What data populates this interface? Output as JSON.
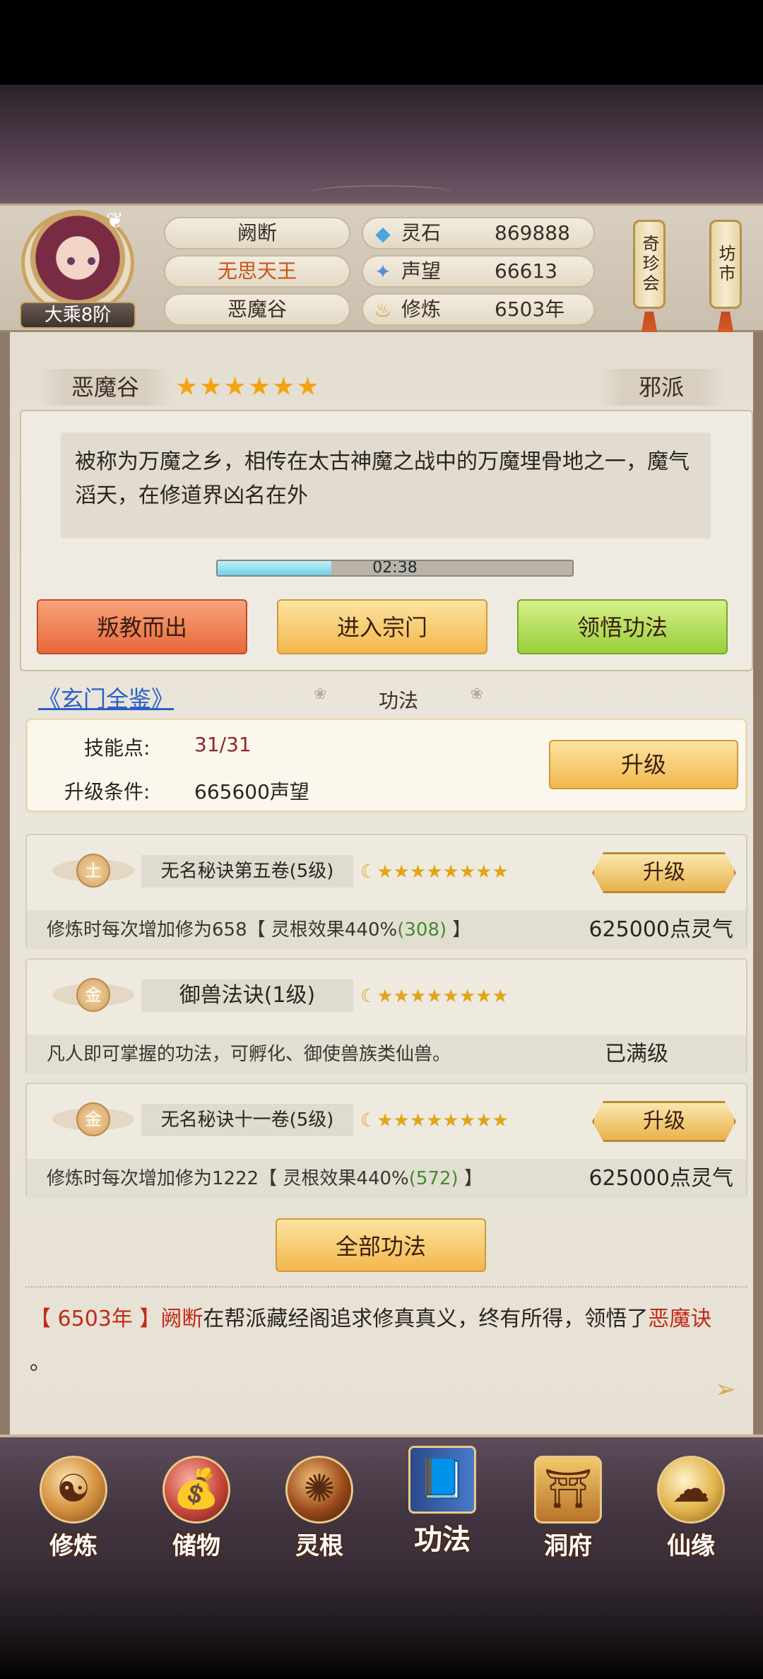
{
  "player": {
    "rank": "大乘8阶",
    "name": "阙断",
    "title": "无思天王",
    "sect": "恶魔谷"
  },
  "resources": [
    {
      "icon": "spirit-stone-icon",
      "label": "灵石",
      "value": "869888"
    },
    {
      "icon": "prestige-icon",
      "label": "声望",
      "value": "66613"
    },
    {
      "icon": "cultivation-icon",
      "label": "修炼",
      "value": "6503年"
    }
  ],
  "side_buttons": {
    "treasure": "奇珍会",
    "market": "坊市"
  },
  "sect_info": {
    "name": "恶魔谷",
    "stars": "★★★★★★",
    "faction": "邪派",
    "description": "被称为万魔之乡，相传在太古神魔之战中的万魔埋骨地之一，魔气滔天，在修道界凶名在外",
    "timer": "02:38",
    "timer_progress": 0.32
  },
  "actions": {
    "betray": "叛教而出",
    "enter": "进入宗门",
    "comprehend": "领悟功法"
  },
  "techniques_header": {
    "book_link": "《玄门全鉴》",
    "label": "功法"
  },
  "skill_points": {
    "points_label": "技能点:",
    "points_value": "31/31",
    "condition_label": "升级条件:",
    "condition_value": "665600声望",
    "upgrade": "升级"
  },
  "techniques": [
    {
      "element": "土",
      "name": "无名秘诀第五卷(5级)",
      "stars": "★★★★★★★★",
      "desc_prefix": "修炼时每次增加修为658【 灵根效果440%",
      "desc_bonus": "(308)",
      "desc_suffix": " 】",
      "cost": "625000点灵气",
      "button": "升级"
    },
    {
      "element": "金",
      "name": "御兽法诀(1级)",
      "stars": "★★★★★★★★",
      "desc_prefix": "凡人即可掌握的功法，可孵化、御使兽族类仙兽。",
      "desc_bonus": "",
      "desc_suffix": "",
      "cost": "已满级",
      "button": ""
    },
    {
      "element": "金",
      "name": "无名秘诀十一卷(5级)",
      "stars": "★★★★★★★★",
      "desc_prefix": "修炼时每次增加修为1222【 灵根效果440%",
      "desc_bonus": "(572)",
      "desc_suffix": " 】",
      "cost": "625000点灵气",
      "button": "升级"
    }
  ],
  "all_techniques": "全部功法",
  "log": {
    "year": "【 6503年 】",
    "name": "阙断",
    "middle": "在帮派藏经阁追求修真真义，终有所得，领悟了",
    "technique": "恶魔诀",
    "end": "。"
  },
  "nav": [
    {
      "label": "修炼",
      "icon": "meditating-monk-icon",
      "glyph": "☯"
    },
    {
      "label": "储物",
      "icon": "storage-bag-icon",
      "glyph": "💰"
    },
    {
      "label": "灵根",
      "icon": "spirit-root-icon",
      "glyph": "✺"
    },
    {
      "label": "功法",
      "icon": "technique-book-icon",
      "glyph": "📘"
    },
    {
      "label": "洞府",
      "icon": "cave-dwelling-icon",
      "glyph": "⛩"
    },
    {
      "label": "仙缘",
      "icon": "immortal-fate-icon",
      "glyph": "☁"
    }
  ]
}
